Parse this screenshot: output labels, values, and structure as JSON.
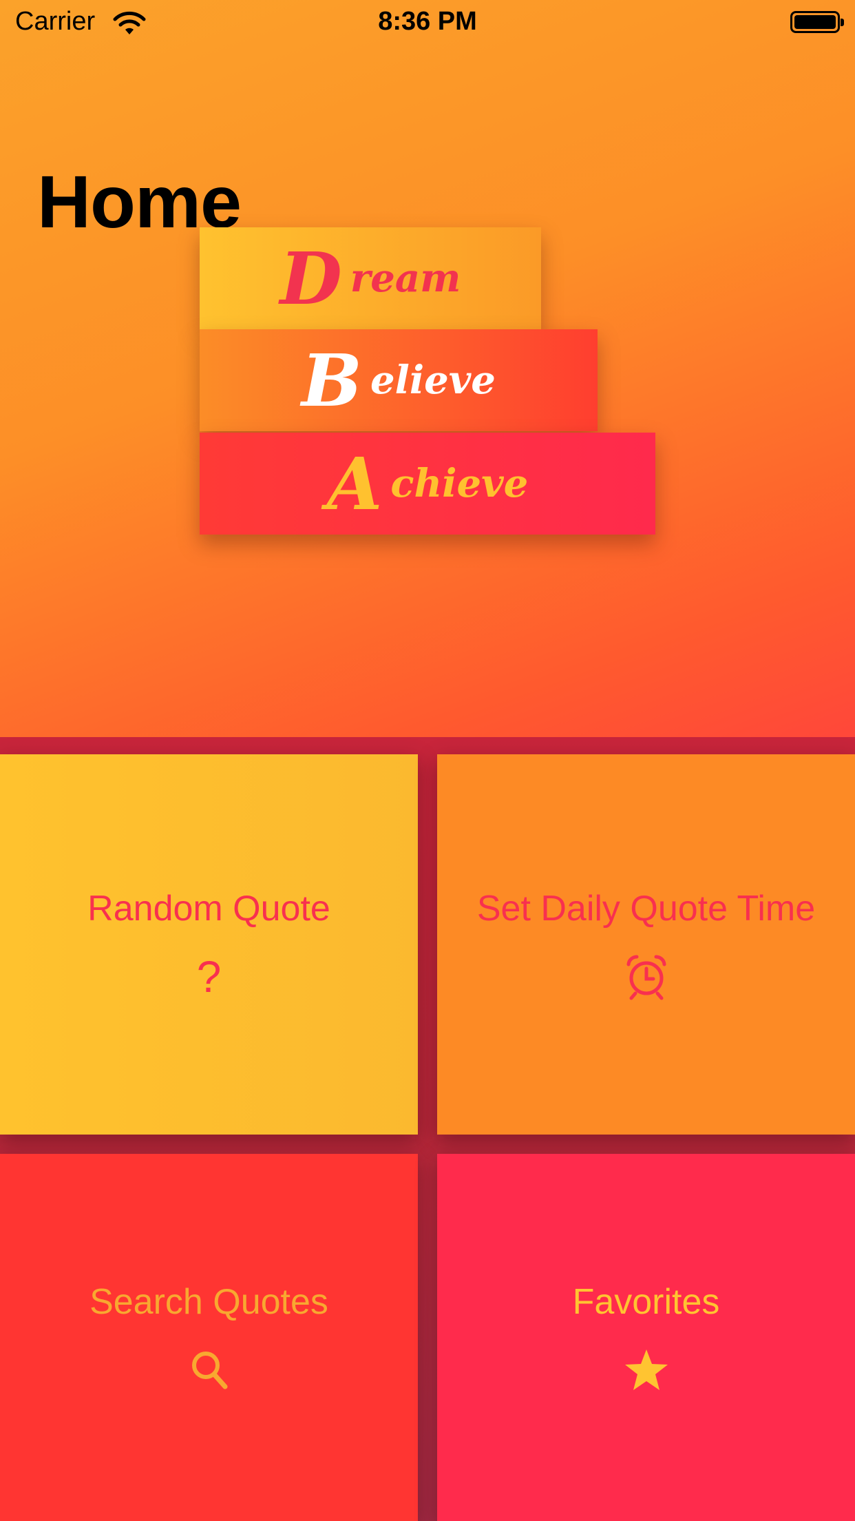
{
  "status_bar": {
    "carrier": "Carrier",
    "time": "8:36 PM",
    "icons": [
      "wifi-icon",
      "battery-icon"
    ]
  },
  "page": {
    "title": "Home"
  },
  "logo": {
    "lines": [
      {
        "initial": "D",
        "rest": "ream"
      },
      {
        "initial": "B",
        "rest": "elieve"
      },
      {
        "initial": "A",
        "rest": "chieve"
      }
    ]
  },
  "tiles": {
    "random": {
      "label": "Random Quote",
      "icon_glyph": "?",
      "icon": "question-mark-icon"
    },
    "daily": {
      "label": "Set Daily Quote Time",
      "icon": "alarm-clock-icon"
    },
    "search": {
      "label": "Search Quotes",
      "icon": "search-icon"
    },
    "favorites": {
      "label": "Favorites",
      "icon": "star-icon"
    }
  },
  "colors": {
    "accent_pink": "#f8304f",
    "accent_yellow": "#ffc431",
    "tile_yellow": "#ffc22e",
    "tile_orange": "#fd8a25",
    "tile_red": "#ff3532",
    "tile_pink": "#ff2b4c"
  }
}
